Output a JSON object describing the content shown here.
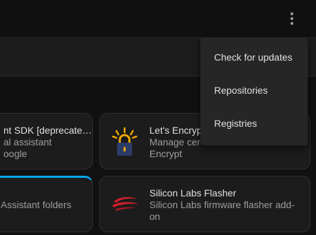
{
  "menu": {
    "items": [
      {
        "label": "Check for updates"
      },
      {
        "label": "Repositories"
      },
      {
        "label": "Registries"
      }
    ]
  },
  "cards": [
    {
      "title": "nt SDK [deprecate…",
      "desc": [
        "al assistant",
        "oogle"
      ],
      "icon": ""
    },
    {
      "title": "Let's Encryp",
      "desc": [
        "Manage cer",
        "Encrypt"
      ],
      "icon": "lets-encrypt-lock-icon"
    },
    {
      "title": "",
      "desc": [
        "Assistant folders"
      ],
      "icon": ""
    },
    {
      "title": "Silicon Labs Flasher",
      "desc": [
        "Silicon Labs firmware flasher add-",
        "on"
      ],
      "icon": "silicon-labs-logo-icon"
    }
  ],
  "colors": {
    "background": "#111111",
    "card": "#1c1c1c",
    "menu": "#262626",
    "accent": "#03a9f4"
  }
}
